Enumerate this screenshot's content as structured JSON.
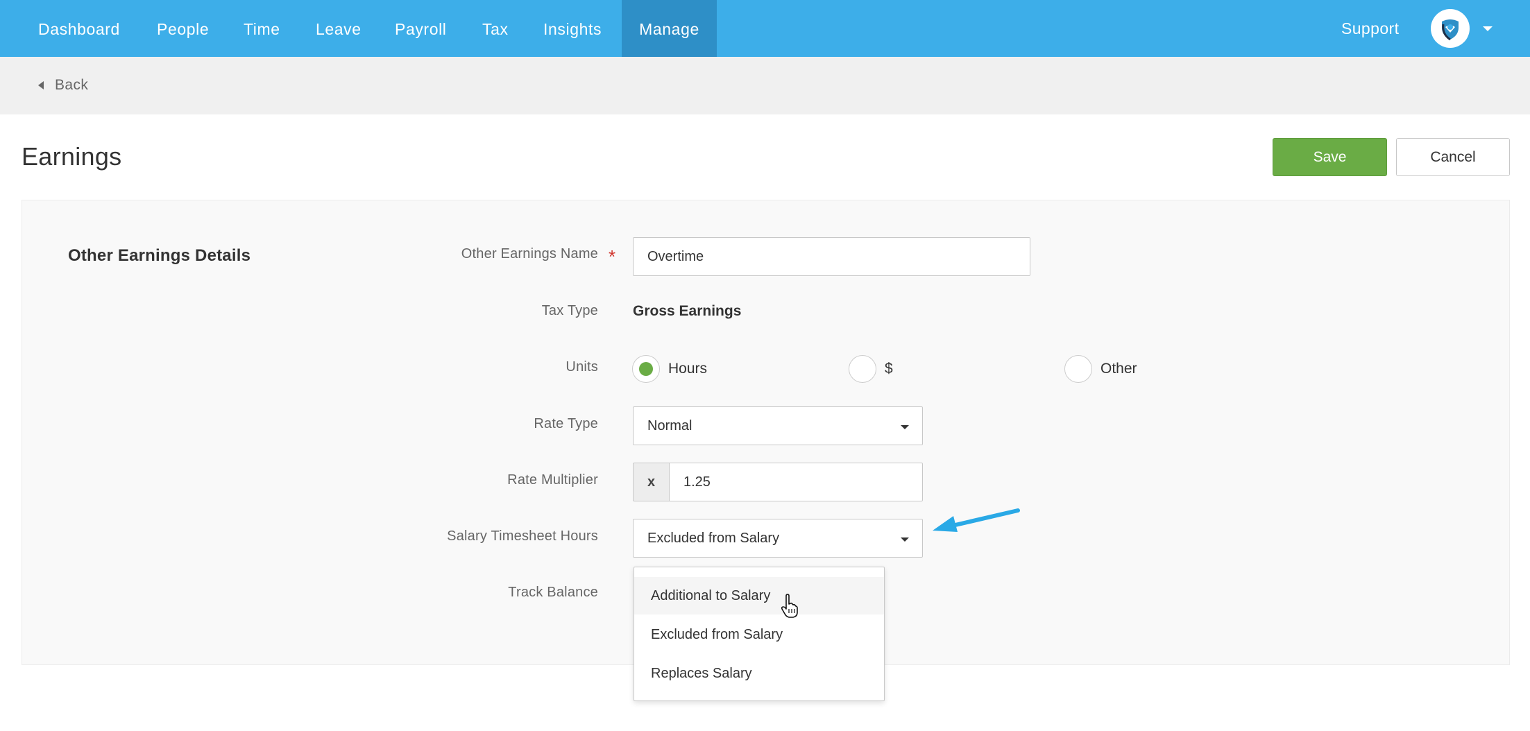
{
  "nav": {
    "items": [
      {
        "label": "Dashboard",
        "active": false
      },
      {
        "label": "People",
        "active": false
      },
      {
        "label": "Time",
        "active": false
      },
      {
        "label": "Leave",
        "active": false
      },
      {
        "label": "Payroll",
        "active": false
      },
      {
        "label": "Tax",
        "active": false
      },
      {
        "label": "Insights",
        "active": false
      },
      {
        "label": "Manage",
        "active": true
      }
    ],
    "support_label": "Support",
    "avatar_icon": "heart-shield-logo-icon",
    "menu_icon": "caret-down-icon"
  },
  "back": {
    "label": "Back",
    "icon": "caret-left-icon"
  },
  "page": {
    "title": "Earnings"
  },
  "actions": {
    "save_label": "Save",
    "cancel_label": "Cancel"
  },
  "form": {
    "section_title": "Other Earnings Details",
    "name": {
      "label": "Other Earnings Name",
      "required_mark": "*",
      "value": "Overtime"
    },
    "tax_type": {
      "label": "Tax Type",
      "value": "Gross Earnings"
    },
    "units": {
      "label": "Units",
      "options": [
        {
          "label": "Hours",
          "selected": true
        },
        {
          "label": "$",
          "selected": false
        },
        {
          "label": "Other",
          "selected": false
        }
      ]
    },
    "rate_type": {
      "label": "Rate Type",
      "value": "Normal"
    },
    "rate_multiplier": {
      "label": "Rate Multiplier",
      "prefix": "x",
      "value": "1.25"
    },
    "salary_timesheet_hours": {
      "label": "Salary Timesheet Hours",
      "value": "Excluded from Salary",
      "options": [
        "Additional to Salary",
        "Excluded from Salary",
        "Replaces Salary"
      ],
      "hovered_option": "Additional to Salary"
    },
    "track_balance": {
      "label": "Track Balance"
    }
  },
  "colors": {
    "nav_bg": "#3daee9",
    "nav_active": "#2e8fc7",
    "save_green": "#6aac45",
    "required_red": "#d0342c",
    "annotation_arrow": "#2aa9e6"
  }
}
